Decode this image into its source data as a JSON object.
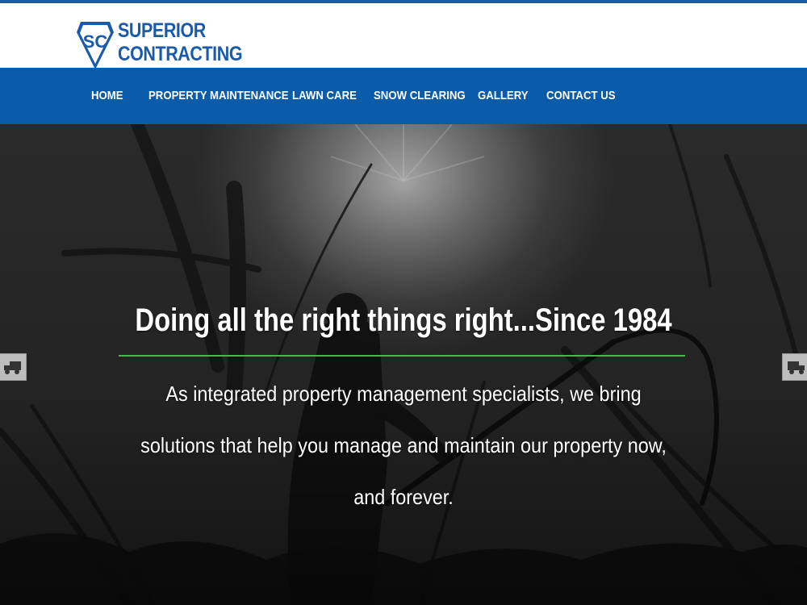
{
  "brand": {
    "name_line1": "SUPERIOR",
    "name_line2": "CONTRACTING",
    "monogram": "SC",
    "color": "#1b5aa8"
  },
  "nav": {
    "items": [
      {
        "label": "HOME"
      },
      {
        "label": "PROPERTY MAINTENANCE"
      },
      {
        "label": "LAWN CARE"
      },
      {
        "label": "SNOW CLEARING"
      },
      {
        "label": "GALLERY"
      },
      {
        "label": "CONTACT US"
      }
    ],
    "background": "#0b5ca8"
  },
  "hero": {
    "title": "Doing all the right things right...Since 1984",
    "subtitle": "As integrated property management specialists, we bring solutions that help you manage and maintain our property now, and forever.",
    "accent_rule_color": "#46b553",
    "prev_icon": "truck-icon",
    "next_icon": "truck-icon"
  }
}
